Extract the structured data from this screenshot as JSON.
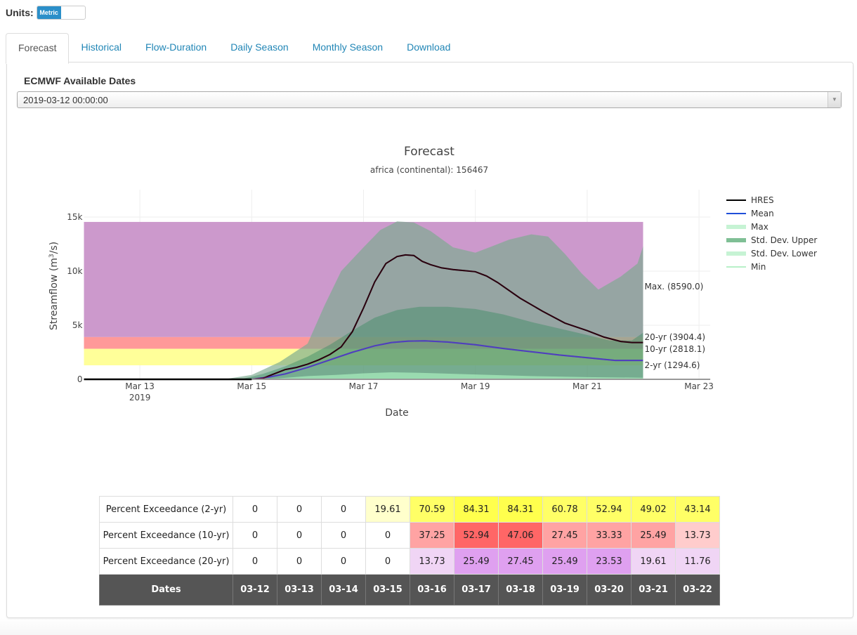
{
  "units": {
    "label": "Units:",
    "toggle_value": "Metric"
  },
  "tabs": [
    {
      "label": "Forecast",
      "active": true
    },
    {
      "label": "Historical",
      "active": false
    },
    {
      "label": "Flow-Duration",
      "active": false
    },
    {
      "label": "Daily Season",
      "active": false
    },
    {
      "label": "Monthly Season",
      "active": false
    },
    {
      "label": "Download",
      "active": false
    }
  ],
  "dates_selector": {
    "label": "ECMWF Available Dates",
    "selected": "2019-03-12 00:00:00"
  },
  "chart_data": {
    "type": "area",
    "title": "Forecast",
    "subtitle": "africa (continental): 156467",
    "xlabel": "Date",
    "ylabel": "Streamflow (m³/s)",
    "ylim": [
      0,
      15500
    ],
    "xlim_days": [
      "2019-03-12",
      "2019-03-23"
    ],
    "x_ticks": [
      {
        "day": 1,
        "label": "Mar 13",
        "sublabel": "2019"
      },
      {
        "day": 3,
        "label": "Mar 15",
        "sublabel": ""
      },
      {
        "day": 5,
        "label": "Mar 17",
        "sublabel": ""
      },
      {
        "day": 7,
        "label": "Mar 19",
        "sublabel": ""
      },
      {
        "day": 9,
        "label": "Mar 21",
        "sublabel": ""
      },
      {
        "day": 11,
        "label": "Mar 23",
        "sublabel": ""
      }
    ],
    "y_ticks": [
      {
        "value": 0,
        "label": "0"
      },
      {
        "value": 5000,
        "label": "5k"
      },
      {
        "value": 10000,
        "label": "10k"
      },
      {
        "value": 15000,
        "label": "15k"
      }
    ],
    "grid": true,
    "legend_position": "top-right",
    "legend": [
      {
        "name": "HRES",
        "color": "#000000",
        "style": "line"
      },
      {
        "name": "Mean",
        "color": "#1f4fd8",
        "style": "line"
      },
      {
        "name": "Max",
        "color": "#c6f3d4",
        "style": "band"
      },
      {
        "name": "Std. Dev. Upper",
        "color": "#7fbf95",
        "style": "band-dark"
      },
      {
        "name": "Std. Dev. Lower",
        "color": "#c6f3d4",
        "style": "band"
      },
      {
        "name": "Min",
        "color": "#a8ecb8",
        "style": "thin"
      }
    ],
    "return_periods": [
      {
        "label": "Max. (8590.0)",
        "low": 3904.4,
        "high": 14550,
        "color": "#cc99cc"
      },
      {
        "label": "20-yr (3904.4)",
        "low": 2818.1,
        "high": 3904.4,
        "color": "#ff9999"
      },
      {
        "label": "10-yr (2818.1)",
        "low": 1294.6,
        "high": 2818.1,
        "color": "#ffff99"
      },
      {
        "label": "2-yr (1294.6)",
        "value": 1294.6
      }
    ],
    "return_period_end_day": 10,
    "series": [
      {
        "name": "Max",
        "x": [
          0,
          2.5,
          3.0,
          3.5,
          4.0,
          4.3,
          4.6,
          5.0,
          5.3,
          5.6,
          5.9,
          6.2,
          6.6,
          7.0,
          7.3,
          7.6,
          8.0,
          8.3,
          8.6,
          8.9,
          9.2,
          9.6,
          9.9,
          10.0
        ],
        "values": [
          0,
          0,
          400,
          1600,
          3300,
          6800,
          10000,
          12200,
          13800,
          14600,
          14500,
          13700,
          12200,
          11700,
          12300,
          12900,
          13400,
          13200,
          11600,
          9800,
          8300,
          9500,
          10700,
          12300
        ]
      },
      {
        "name": "Std. Dev. Upper",
        "x": [
          0,
          2.8,
          3.2,
          3.6,
          4.0,
          4.4,
          4.8,
          5.2,
          5.6,
          6.0,
          6.5,
          7.0,
          7.5,
          8.0,
          8.5,
          9.0,
          9.4,
          9.8,
          10.0
        ],
        "values": [
          0,
          0,
          500,
          1200,
          2100,
          3200,
          4500,
          5700,
          6400,
          6700,
          6700,
          6500,
          6000,
          5300,
          4700,
          4100,
          3600,
          3600,
          4300
        ]
      },
      {
        "name": "Std. Dev. Lower",
        "x": [
          0,
          3.0,
          3.5,
          4.0,
          4.5,
          5.0,
          5.5,
          6.0,
          7.0,
          8.0,
          9.0,
          10.0
        ],
        "values": [
          0,
          0,
          100,
          300,
          400,
          550,
          650,
          600,
          450,
          300,
          200,
          150
        ]
      },
      {
        "name": "Min",
        "x": [
          0,
          3.5,
          4.5,
          5.5,
          7.0,
          8.0,
          9.0,
          10.0
        ],
        "values": [
          0,
          0,
          50,
          100,
          60,
          40,
          20,
          20
        ]
      },
      {
        "name": "Mean",
        "x": [
          0,
          3.0,
          3.3,
          3.6,
          4.0,
          4.4,
          4.8,
          5.2,
          5.5,
          5.8,
          6.1,
          6.5,
          7.0,
          7.5,
          8.0,
          8.5,
          9.0,
          9.5,
          10.0
        ],
        "values": [
          0,
          0,
          200,
          500,
          1100,
          1800,
          2500,
          3100,
          3400,
          3530,
          3550,
          3450,
          3200,
          2850,
          2550,
          2250,
          2000,
          1750,
          1750
        ]
      },
      {
        "name": "HRES",
        "x": [
          0,
          3.0,
          3.2,
          3.4,
          3.6,
          3.8,
          4.0,
          4.2,
          4.4,
          4.6,
          4.8,
          5.0,
          5.2,
          5.4,
          5.6,
          5.75,
          5.9,
          6.05,
          6.2,
          6.4,
          6.6,
          6.8,
          7.0,
          7.2,
          7.4,
          7.8,
          8.2,
          8.6,
          9.0,
          9.3,
          9.6,
          9.8,
          10.0
        ],
        "values": [
          0,
          0,
          100,
          500,
          900,
          1100,
          1400,
          1800,
          2300,
          3000,
          4400,
          6600,
          9000,
          10700,
          11350,
          11500,
          11450,
          10900,
          10600,
          10300,
          10150,
          10050,
          9950,
          9550,
          8950,
          7500,
          6300,
          5200,
          4500,
          3900,
          3500,
          3400,
          3400
        ]
      }
    ]
  },
  "exceedance_table": {
    "rows": [
      {
        "label": "Percent Exceedance (2-yr)",
        "values": [
          "0",
          "0",
          "0",
          "19.61",
          "70.59",
          "84.31",
          "84.31",
          "60.78",
          "52.94",
          "49.02",
          "43.14"
        ],
        "colors": [
          "#ffffff",
          "#ffffff",
          "#ffffff",
          "#ffffcc",
          "#ffff66",
          "#ffff4d",
          "#ffff4d",
          "#ffff66",
          "#ffff66",
          "#ffff66",
          "#ffff66"
        ]
      },
      {
        "label": "Percent Exceedance (10-yr)",
        "values": [
          "0",
          "0",
          "0",
          "0",
          "37.25",
          "52.94",
          "47.06",
          "27.45",
          "33.33",
          "25.49",
          "13.73"
        ],
        "colors": [
          "#ffffff",
          "#ffffff",
          "#ffffff",
          "#ffffff",
          "#ffa3a3",
          "#ff6666",
          "#ff6666",
          "#ffa3a3",
          "#ffa3a3",
          "#ffa3a3",
          "#ffcccc"
        ]
      },
      {
        "label": "Percent Exceedance (20-yr)",
        "values": [
          "0",
          "0",
          "0",
          "0",
          "13.73",
          "25.49",
          "27.45",
          "25.49",
          "23.53",
          "19.61",
          "11.76"
        ],
        "colors": [
          "#ffffff",
          "#ffffff",
          "#ffffff",
          "#ffffff",
          "#f0d5f5",
          "#dfa0f0",
          "#dfa0f0",
          "#dfa0f0",
          "#dfa0f0",
          "#f0d5f5",
          "#f0d5f5"
        ]
      }
    ],
    "footer": {
      "label": "Dates",
      "dates": [
        "03-12",
        "03-13",
        "03-14",
        "03-15",
        "03-16",
        "03-17",
        "03-18",
        "03-19",
        "03-20",
        "03-21",
        "03-22"
      ]
    }
  }
}
